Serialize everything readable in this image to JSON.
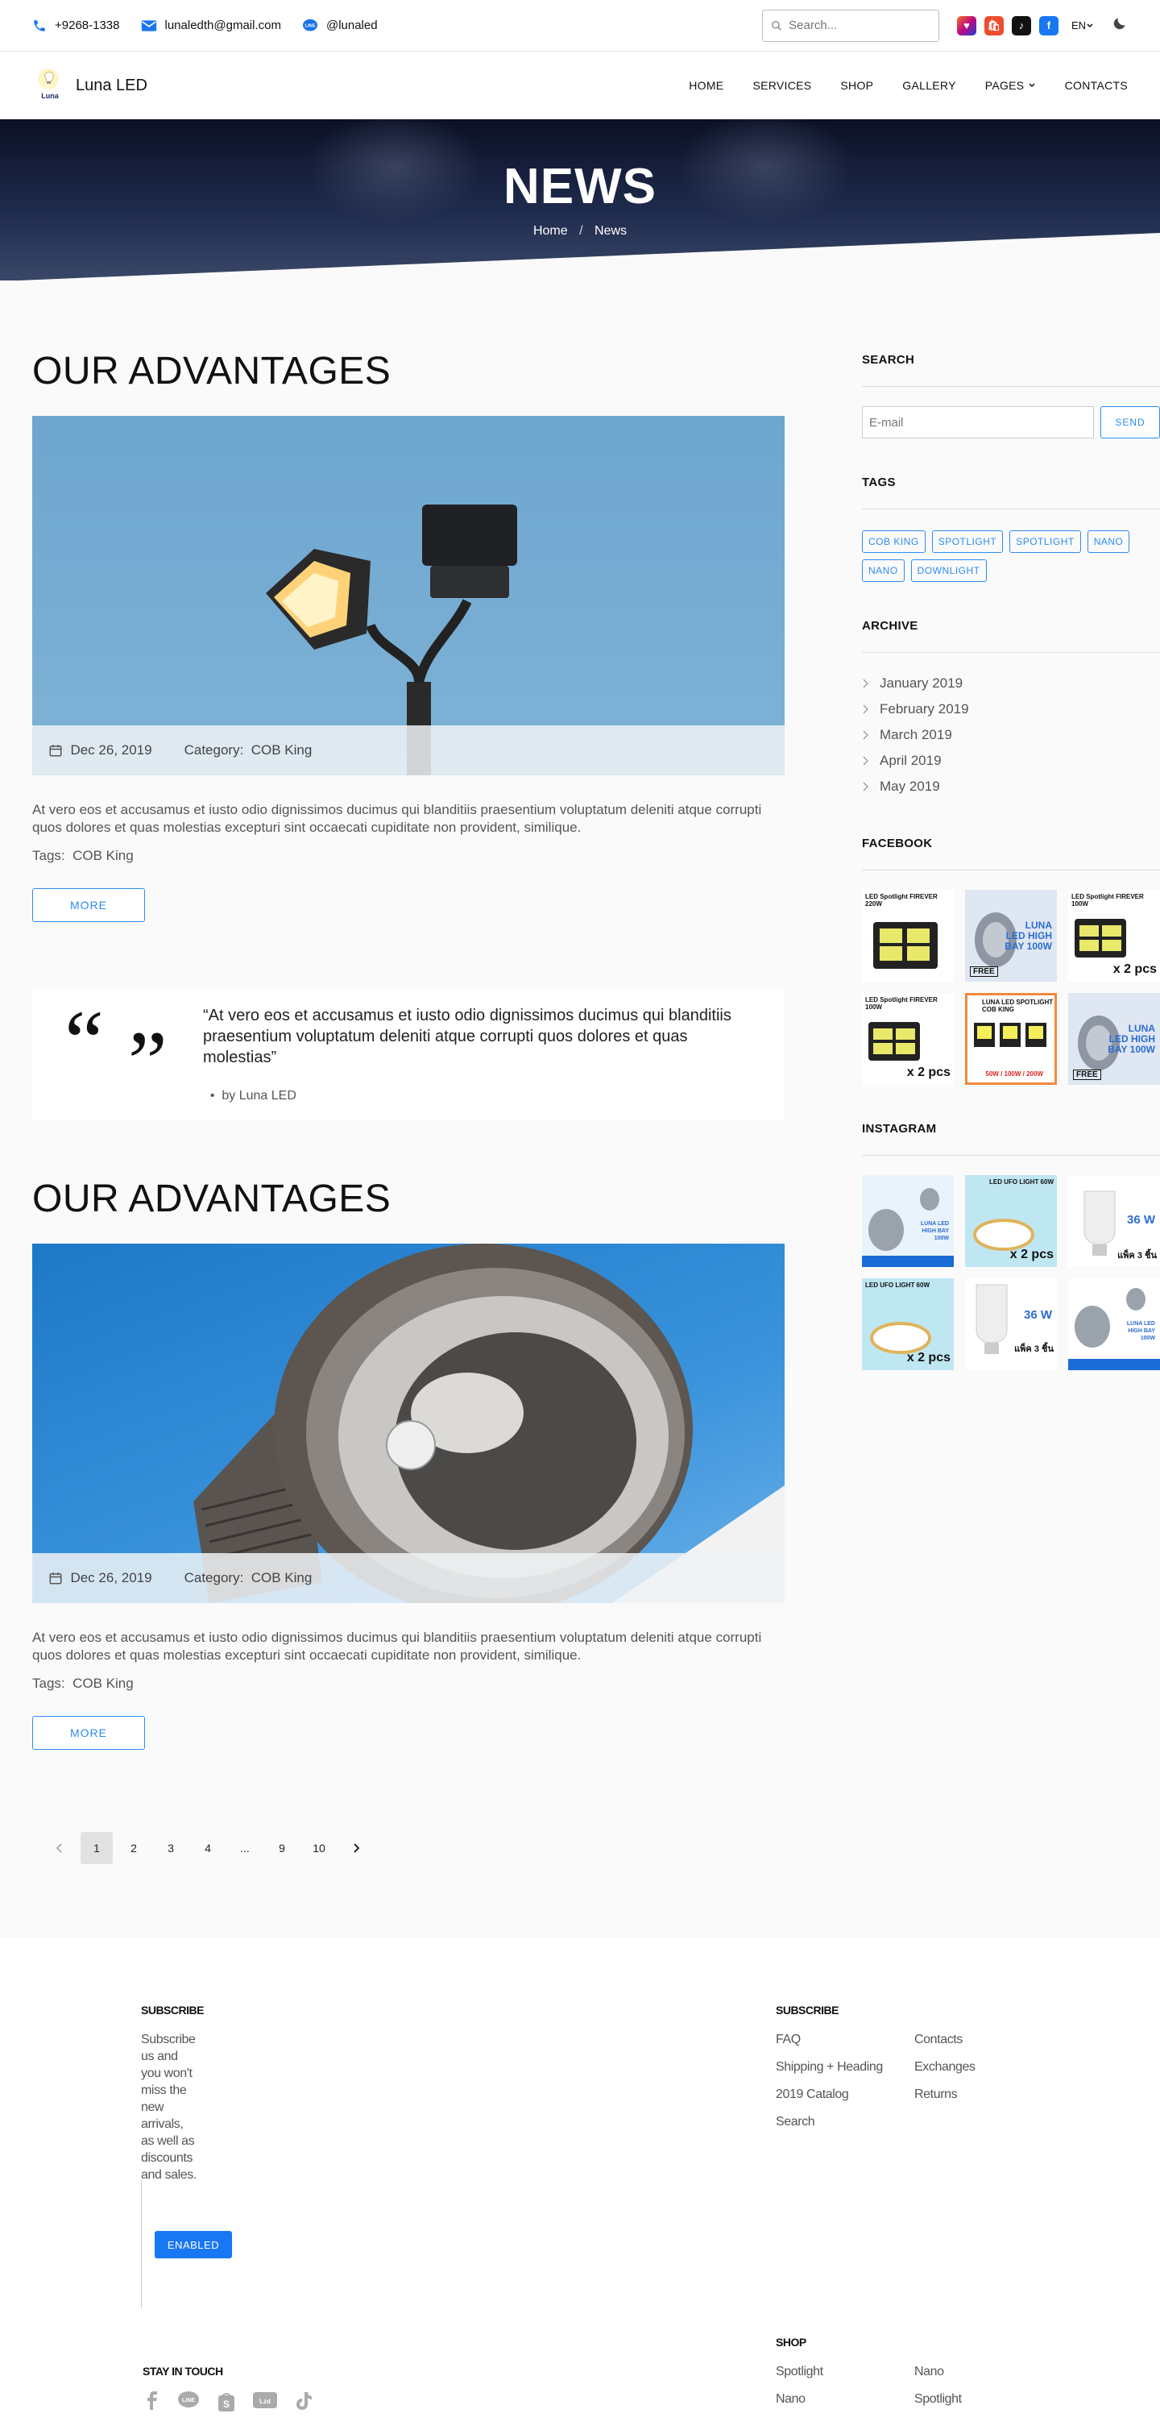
{
  "topbar": {
    "phone": "+9268-1338",
    "email": "lunaledth@gmail.com",
    "line": "@lunaled",
    "search_placeholder": "Search...",
    "lang": "EN"
  },
  "nav": {
    "brand": "Luna LED",
    "logo_text": "Luna",
    "items": [
      "HOME",
      "SERVICES",
      "SHOP",
      "GALLERY",
      "PAGES",
      "CONTACTS"
    ]
  },
  "hero": {
    "title": "NEWS",
    "crumb_home": "Home",
    "crumb_sep": "/",
    "crumb_current": "News"
  },
  "posts": [
    {
      "title": "OUR ADVANTAGES",
      "date": "Dec 26, 2019",
      "category_label": "Category:",
      "category": "COB King",
      "text": "At vero eos et accusamus et iusto odio dignissimos ducimus qui blanditiis praesentium voluptatum deleniti atque corrupti quos dolores et quas molestias excepturi sint occaecati cupiditate non provident, similique.",
      "tags_label": "Tags:",
      "tags": "COB King",
      "more": "MORE"
    },
    {
      "title": "OUR ADVANTAGES",
      "date": "Dec 26, 2019",
      "category_label": "Category:",
      "category": "COB King",
      "text": "At vero eos et accusamus et iusto odio dignissimos ducimus qui blanditiis praesentium voluptatum deleniti atque corrupti quos dolores et quas molestias excepturi sint occaecati cupiditate non provident, similique.",
      "tags_label": "Tags:",
      "tags": "COB King",
      "more": "MORE"
    }
  ],
  "quote": {
    "text": "“At vero eos et accusamus et iusto odio dignissimos ducimus qui blanditiis praesentium voluptatum deleniti atque corrupti quos dolores et quas molestias”",
    "author": "by Luna LED"
  },
  "pagination": [
    "1",
    "2",
    "3",
    "4",
    "...",
    "9",
    "10"
  ],
  "sidebar": {
    "search_title": "SEARCH",
    "search_placeholder": "E-mail",
    "send": "SEND",
    "tags_title": "TAGS",
    "tags": [
      "COB KING",
      "SPOTLIGHT",
      "SPOTLIGHT",
      "NANO",
      "NANO",
      "DOWNLIGHT"
    ],
    "archive_title": "ARCHIVE",
    "archive": [
      "January 2019",
      "February 2019",
      "March 2019",
      "April 2019",
      "May 2019"
    ],
    "facebook_title": "FACEBOOK",
    "instagram_title": "INSTAGRAM",
    "facebook_thumbs": [
      {
        "head": "LED Spotlight FIREVER 220W",
        "label": "",
        "sub": ""
      },
      {
        "head": "",
        "label": "FREE",
        "sub": "LUNA LED HIGH BAY 100W"
      },
      {
        "head": "LED Spotlight FIREVER 100W",
        "label": "x 2 pcs",
        "sub": ""
      },
      {
        "head": "LED Spotlight FIREVER 100W",
        "label": "x 2 pcs",
        "sub": ""
      },
      {
        "head": "LUNA LED SPOTLIGHT COB KING",
        "label": "50W / 100W / 200W",
        "sub": ""
      },
      {
        "head": "",
        "label": "FREE",
        "sub": "LUNA LED HIGH BAY 100W"
      }
    ],
    "instagram_thumbs": [
      {
        "head": "",
        "label": "",
        "sub": "LUNA LED HIGH BAY 100W"
      },
      {
        "head": "LED UFO LIGHT 60W",
        "label": "x 2 pcs",
        "sub": ""
      },
      {
        "head": "",
        "label": "แพ็ค 3 ชิ้น",
        "sub": "36 W"
      },
      {
        "head": "LED UFO LIGHT 60W",
        "label": "x 2 pcs",
        "sub": ""
      },
      {
        "head": "",
        "label": "แพ็ค 3 ชิ้น",
        "sub": "36 W"
      },
      {
        "head": "",
        "label": "",
        "sub": "LUNA LED HIGH BAY 100W"
      }
    ]
  },
  "footer": {
    "subscribe_title": "SUBSCRIBE",
    "subscribe_text": "Subscribe us and you won't miss the new arrivals, as well as discounts and sales.",
    "enabled": "ENABLED",
    "links_title": "SUBSCRIBE",
    "links": [
      "FAQ",
      "Contacts",
      "Shipping + Heading",
      "Exchanges",
      "2019 Catalog",
      "Returns",
      "Search"
    ],
    "touch_title": "STAY IN TOUCH",
    "shop_title": "SHOP",
    "shop_links": [
      "Spotlight",
      "Nano",
      "Nano",
      "Spotlight"
    ]
  },
  "colors": {
    "accent": "#2d8cf0",
    "facebook": "#1877f2",
    "line": "#1a73e8",
    "footer_button": "#1877f2"
  }
}
